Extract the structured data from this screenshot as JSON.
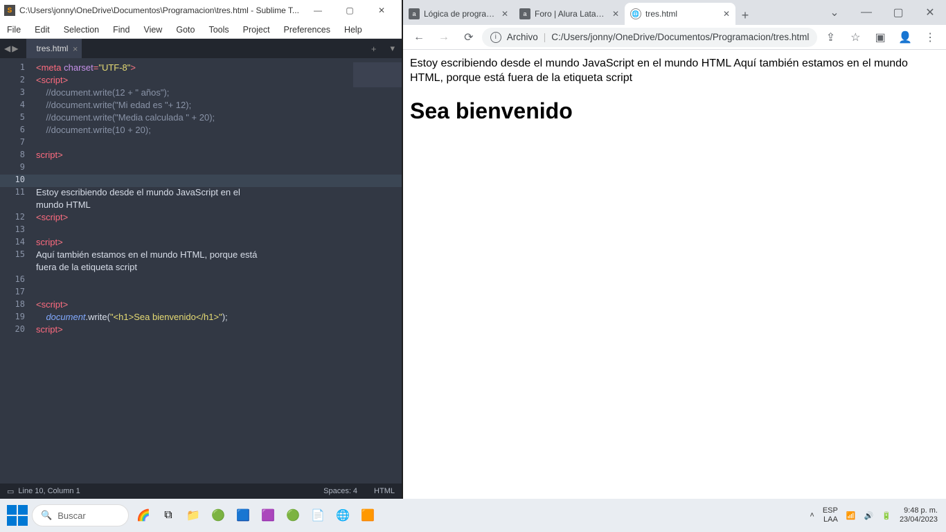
{
  "sublime": {
    "title": "C:\\Users\\jonny\\OneDrive\\Documentos\\Programacion\\tres.html - Sublime T...",
    "menu": [
      "File",
      "Edit",
      "Selection",
      "Find",
      "View",
      "Goto",
      "Tools",
      "Project",
      "Preferences",
      "Help"
    ],
    "tab": "tres.html",
    "status": {
      "pos": "Line 10, Column 1",
      "spaces": "Spaces: 4",
      "lang": "HTML"
    },
    "lines": [
      1,
      2,
      3,
      4,
      5,
      6,
      7,
      8,
      9,
      10,
      11,
      12,
      13,
      14,
      15,
      16,
      17,
      18,
      19,
      20
    ],
    "highlight_line": 10,
    "code": {
      "l1a": "<",
      "l1b": "meta",
      "l1c": " charset",
      "l1d": "=",
      "l1e": "\"UTF-8\"",
      "l1f": ">",
      "l2a": "<",
      "l2b": "script",
      "l2c": ">",
      "l3": "    //document.write(12 + \" años\");",
      "l4": "    //document.write(\"Mi edad es \"+ 12);",
      "l5": "    //document.write(\"Media calculada \" + 20);",
      "l6": "    //document.write(10 + 20);",
      "l8a": "</",
      "l8b": "script",
      "l8c": ">",
      "l11": "Estoy escribiendo desde el mundo JavaScript en el\nmundo HTML",
      "l11a": "Estoy escribiendo desde el mundo JavaScript en el",
      "l11b": "mundo HTML",
      "l12a": "<",
      "l12b": "script",
      "l12c": ">",
      "l14a": "</",
      "l14b": "script",
      "l14c": ">",
      "l15a": "Aquí también estamos en el mundo HTML, porque está",
      "l15b": "fuera de la etiqueta script",
      "l18a": "<",
      "l18b": "script",
      "l18c": ">",
      "l19a": "    ",
      "l19b": "document",
      "l19c": ".write(",
      "l19d": "\"<h1>Sea bienvenido</h1>\"",
      "l19e": ");",
      "l20a": "</",
      "l20b": "script",
      "l20c": ">"
    }
  },
  "chrome": {
    "tabs": [
      {
        "title": "Lógica de program...",
        "fav": "a"
      },
      {
        "title": "Foro | Alura Latam ...",
        "fav": "a"
      },
      {
        "title": "tres.html",
        "fav": "globe",
        "active": true
      }
    ],
    "url_label": "Archivo",
    "url": "C:/Users/jonny/OneDrive/Documentos/Programacion/tres.html",
    "page": {
      "paragraph": "Estoy escribiendo desde el mundo JavaScript en el mundo HTML Aquí también estamos en el mundo HTML, porque está fuera de la etiqueta script",
      "heading": "Sea bienvenido"
    }
  },
  "taskbar": {
    "search_placeholder": "Buscar",
    "lang": "ESP",
    "kbd": "LAA",
    "time": "9:48 p. m.",
    "date": "23/04/2023"
  }
}
